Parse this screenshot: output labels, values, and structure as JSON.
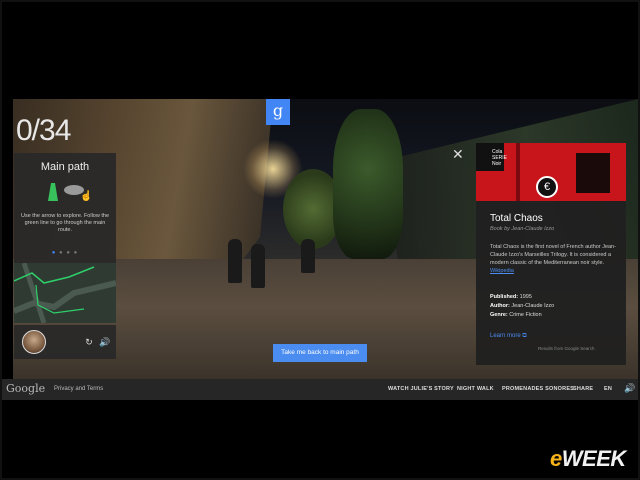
{
  "counter": "0/34",
  "gpin": "g",
  "left_panel": {
    "title": "Main path",
    "instructions": "Use the arrow to explore. Follow the green line to go through the main route.",
    "dots": [
      "●",
      "●",
      "●",
      "●"
    ]
  },
  "user_row": {
    "refresh_icon": "↻",
    "volume_icon": "🔊"
  },
  "right_panel": {
    "close": "✕",
    "share": "<",
    "cover_text": "Cola\nSERIE\nNoir",
    "cover_symbol": "€",
    "title": "Total Chaos",
    "subtitle": "Book by Jean-Claude Izzo",
    "description": "Total Chaos is the first novel of French author Jean-Claude Izzo's Marseilles Trilogy. It is considered a modern classic of the Mediterranean noir style.",
    "wiki_link": "Wikipedia",
    "published_label": "Published:",
    "published": "1995",
    "author_label": "Author:",
    "author": "Jean-Claude Izzo",
    "genre_label": "Genre:",
    "genre": "Crime Fiction",
    "learn_more": "Learn more",
    "results_from": "Results from Google Search"
  },
  "back_button": "Take me back to main path",
  "footer": {
    "logo": "Google",
    "privacy": "Privacy and Terms",
    "nav": [
      "WATCH JULIE'S STORY",
      "NIGHT WALK",
      "PROMENADES SONORES",
      "SHARE",
      "EN"
    ],
    "volume": "🔊"
  },
  "watermark": {
    "e": "e",
    "rest": "WEEK"
  }
}
